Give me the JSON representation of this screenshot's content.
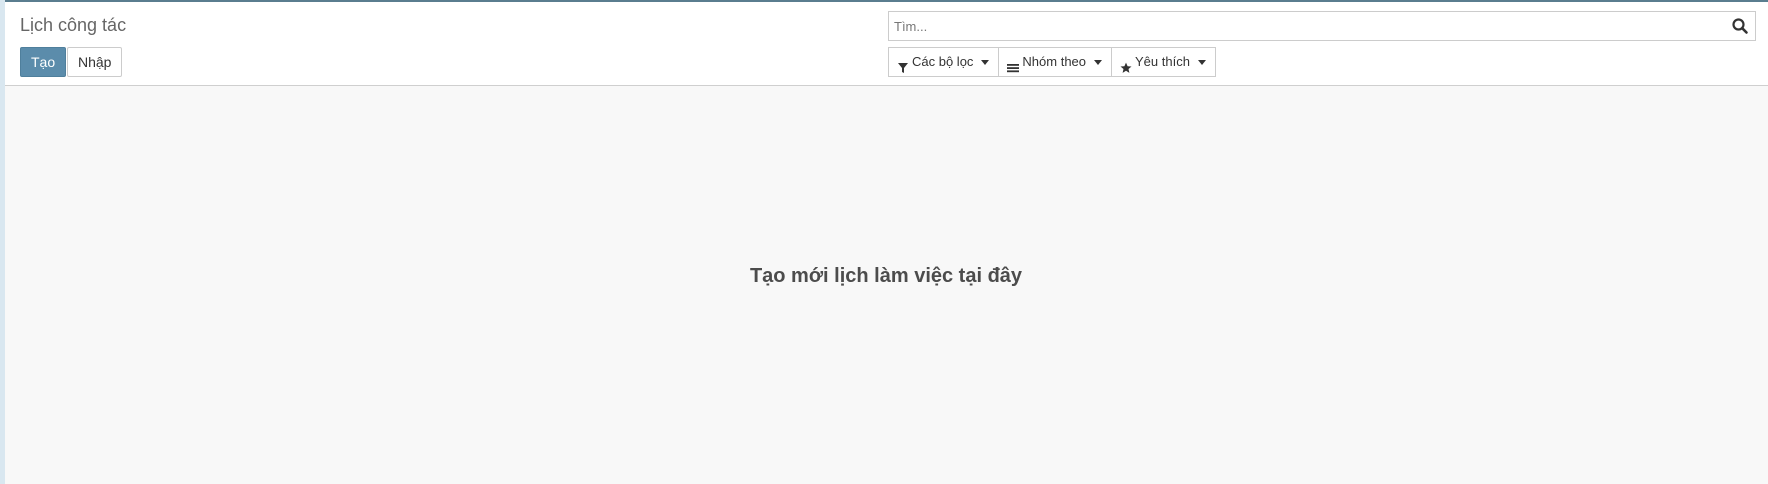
{
  "breadcrumb": {
    "title": "Lịch công tác"
  },
  "actions": {
    "create_label": "Tạo",
    "import_label": "Nhập"
  },
  "search": {
    "placeholder": "Tìm...",
    "icon": "search-icon"
  },
  "filters": {
    "filter_label": "Các bộ lọc",
    "filter_icon": "funnel-icon",
    "groupby_label": "Nhóm theo",
    "groupby_icon": "bars-icon",
    "favorites_label": "Yêu thích",
    "favorites_icon": "star-icon"
  },
  "content": {
    "empty_message": "Tạo mới lịch làm việc tại đây"
  },
  "colors": {
    "primary": "#5b8cab",
    "background": "#f8f8f8",
    "text": "#4c4c4c"
  }
}
